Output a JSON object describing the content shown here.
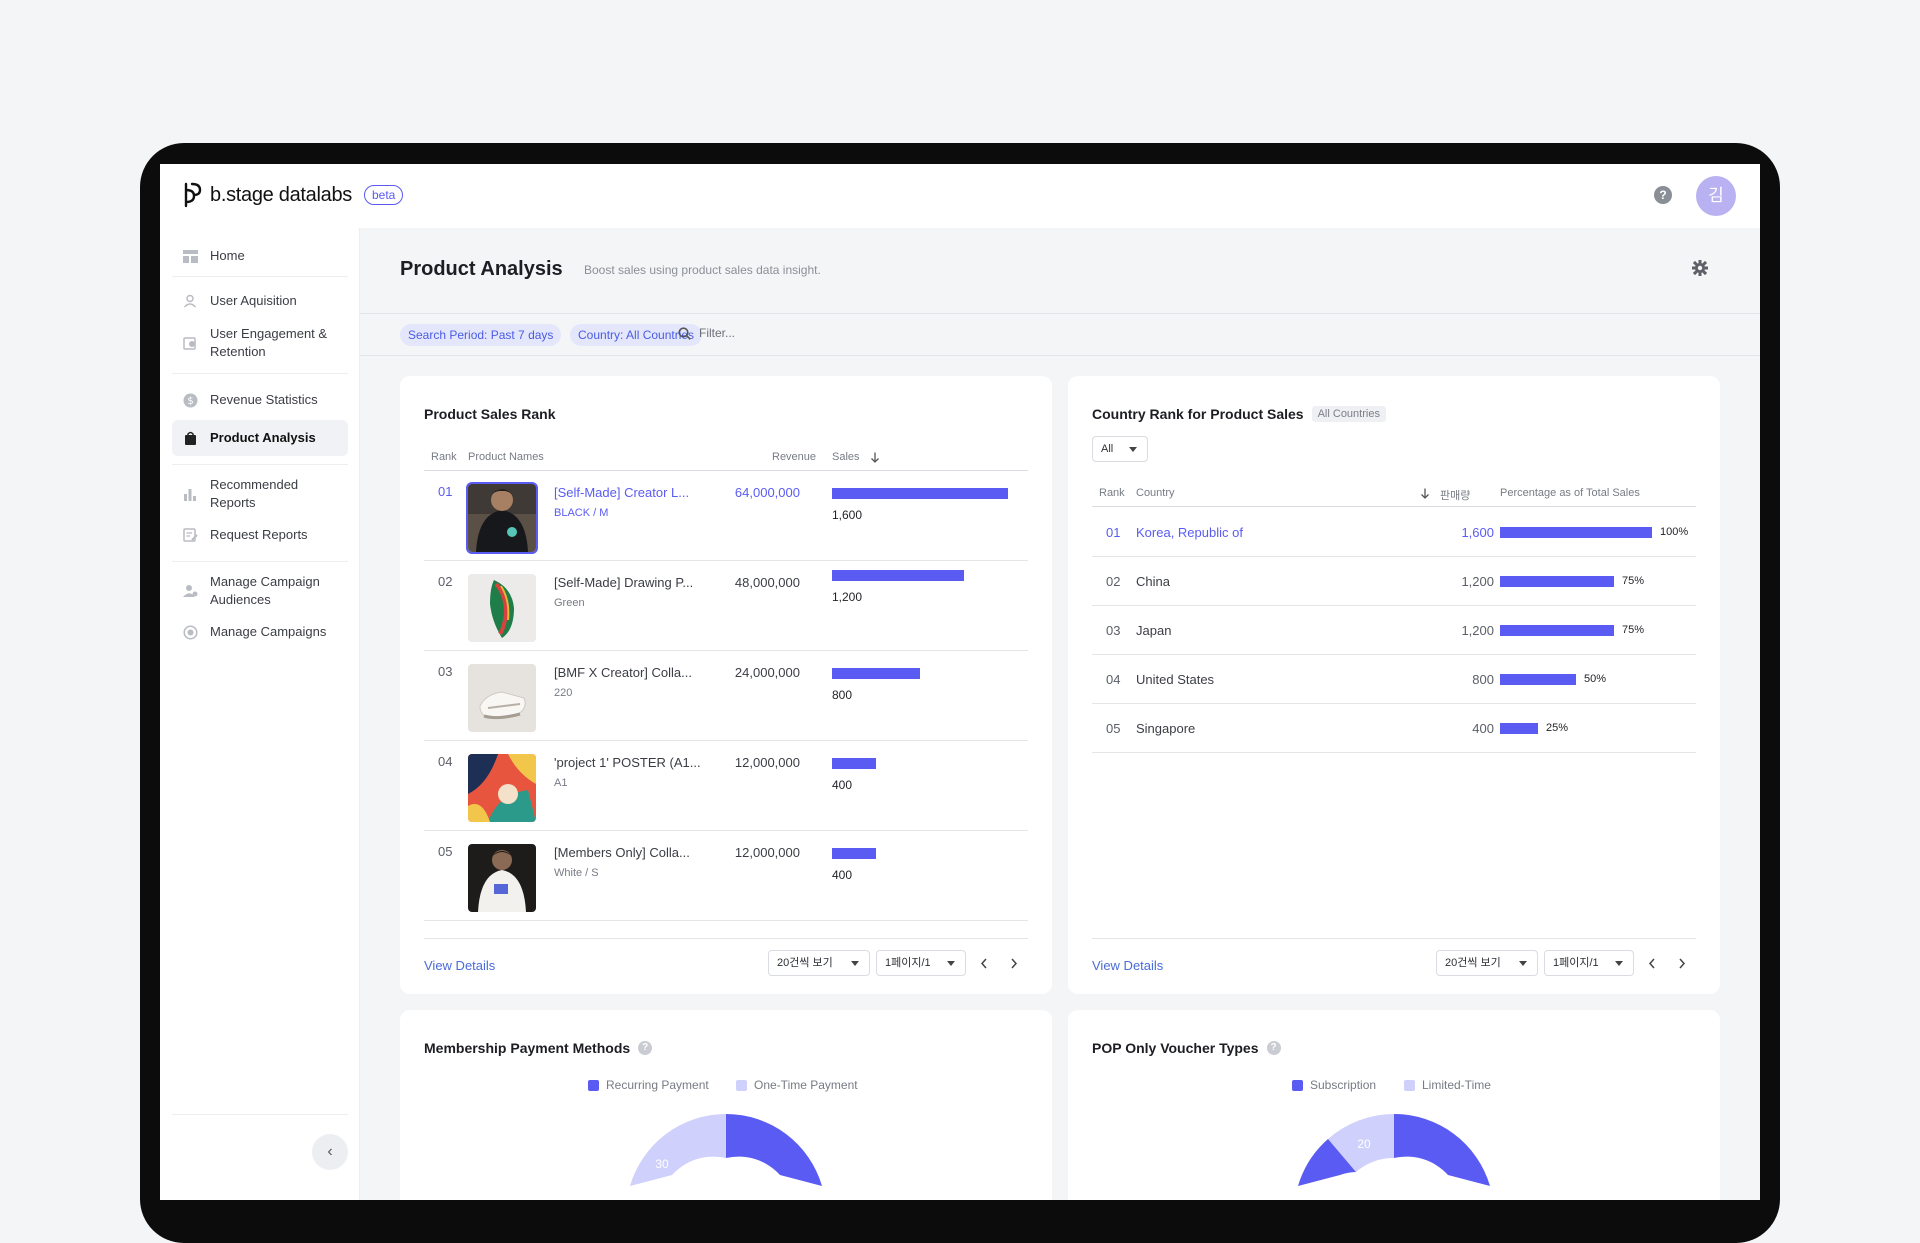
{
  "app": {
    "logo_text": "b.stage datalabs",
    "beta_label": "beta",
    "help_label": "?",
    "avatar_initial": "김"
  },
  "sidebar": {
    "items": [
      {
        "label": "Home",
        "icon": "layout-icon"
      },
      {
        "label": "User Aquisition",
        "icon": "user-icon"
      },
      {
        "label": "User Engagement & Retention",
        "icon": "engagement-icon"
      },
      {
        "label": "Revenue Statistics",
        "icon": "dollar-icon"
      },
      {
        "label": "Product Analysis",
        "icon": "bag-icon"
      },
      {
        "label": "Recommended Reports",
        "icon": "bar-chart-icon"
      },
      {
        "label": "Request Reports",
        "icon": "edit-document-icon"
      },
      {
        "label": "Manage Campaign Audiences",
        "icon": "audience-icon"
      },
      {
        "label": "Manage Campaigns",
        "icon": "target-icon"
      }
    ],
    "collapse_icon": "‹"
  },
  "page": {
    "title": "Product Analysis",
    "subtitle": "Boost sales using product sales data insight.",
    "filters": {
      "period": "Search Period: Past 7 days",
      "country": "Country: All Countries",
      "search_placeholder": "Filter..."
    }
  },
  "product_rank": {
    "title": "Product Sales Rank",
    "headers": {
      "rank": "Rank",
      "name": "Product Names",
      "revenue": "Revenue",
      "sales": "Sales"
    },
    "rows": [
      {
        "rank": "01",
        "name": "[Self-Made] Creator L...",
        "option": "BLACK / M",
        "revenue": "64,000,000",
        "sales": "1,600",
        "sales_value": 1600
      },
      {
        "rank": "02",
        "name": "[Self-Made] Drawing P...",
        "option": "Green",
        "revenue": "48,000,000",
        "sales": "1,200",
        "sales_value": 1200
      },
      {
        "rank": "03",
        "name": "[BMF X Creator] Colla...",
        "option": "220",
        "revenue": "24,000,000",
        "sales": "800",
        "sales_value": 800
      },
      {
        "rank": "04",
        "name": "'project 1' POSTER (A1...",
        "option": "A1",
        "revenue": "12,000,000",
        "sales": "400",
        "sales_value": 400
      },
      {
        "rank": "05",
        "name": "[Members Only] Colla...",
        "option": "White / S",
        "revenue": "12,000,000",
        "sales": "400",
        "sales_value": 400
      }
    ],
    "view_details": "View Details",
    "page_size": "20건씩 보기",
    "page_indicator": "1페이지/1"
  },
  "country_rank": {
    "title": "Country Rank for Product Sales",
    "tag": "All Countries",
    "filter_value": "All",
    "headers": {
      "rank": "Rank",
      "country": "Country",
      "sales": "판매량",
      "pct": "Percentage as of Total Sales"
    },
    "rows": [
      {
        "rank": "01",
        "country": "Korea, Republic of",
        "sales": "1,600",
        "pct": "100%",
        "pct_value": 100
      },
      {
        "rank": "02",
        "country": "China",
        "sales": "1,200",
        "pct": "75%",
        "pct_value": 75
      },
      {
        "rank": "03",
        "country": "Japan",
        "sales": "1,200",
        "pct": "75%",
        "pct_value": 75
      },
      {
        "rank": "04",
        "country": "United States",
        "sales": "800",
        "pct": "50%",
        "pct_value": 50
      },
      {
        "rank": "05",
        "country": "Singapore",
        "sales": "400",
        "pct": "25%",
        "pct_value": 25
      }
    ],
    "view_details": "View Details",
    "page_size": "20건씩 보기",
    "page_indicator": "1페이지/1"
  },
  "membership": {
    "title": "Membership Payment Methods",
    "legend": [
      "Recurring Payment",
      "One-Time Payment"
    ],
    "label_visible": "30",
    "colors": [
      "#5a5bf3",
      "#cfd0fb"
    ]
  },
  "voucher": {
    "title": "POP Only Voucher Types",
    "legend": [
      "Subscription",
      "Limited-Time"
    ],
    "label_visible": "20",
    "colors": [
      "#5a5bf3",
      "#cfd0fb"
    ]
  },
  "accent_color": "#5a5bf3"
}
